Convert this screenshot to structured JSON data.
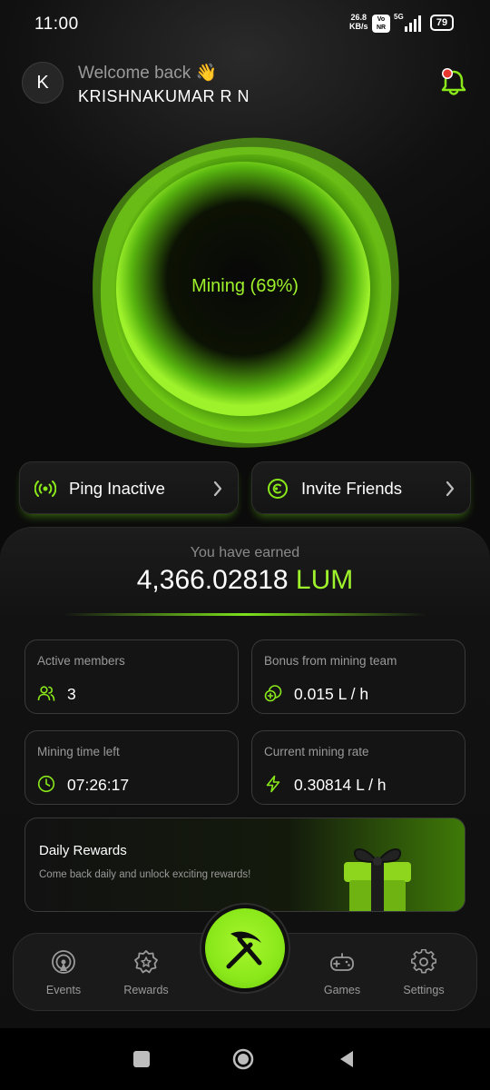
{
  "status_bar": {
    "time": "11:00",
    "net_speed_value": "26.8",
    "net_speed_unit": "KB/s",
    "volte_top": "Vo",
    "volte_bottom": "NR",
    "network_type": "5G",
    "battery": "79"
  },
  "header": {
    "avatar_letter": "K",
    "welcome": "Welcome back 👋",
    "username": "KRISHNAKUMAR R N",
    "bell_icon": "bell-icon",
    "notification_dot_color": "#e8372f"
  },
  "orb": {
    "status_text": "Mining (69%)",
    "progress_percent": 69
  },
  "actions": {
    "ping_label": "Ping Inactive",
    "invite_label": "Invite Friends"
  },
  "earnings": {
    "label": "You have earned",
    "amount": "4,366.02818",
    "unit": "LUM"
  },
  "stats": {
    "members": {
      "title": "Active members",
      "value": "3"
    },
    "bonus": {
      "title": "Bonus from mining team",
      "value": "0.015 L / h"
    },
    "time_left": {
      "title": "Mining time left",
      "value": "07:26:17"
    },
    "rate": {
      "title": "Current mining rate",
      "value": "0.30814 L / h"
    }
  },
  "daily_rewards": {
    "title": "Daily Rewards",
    "description": "Come back daily and unlock exciting rewards!"
  },
  "bottom_nav": {
    "events": "Events",
    "rewards": "Rewards",
    "games": "Games",
    "settings": "Settings"
  },
  "colors": {
    "accent": "#9ef22b",
    "background": "#0d0d0d",
    "card_border": "#3a3a3a"
  }
}
